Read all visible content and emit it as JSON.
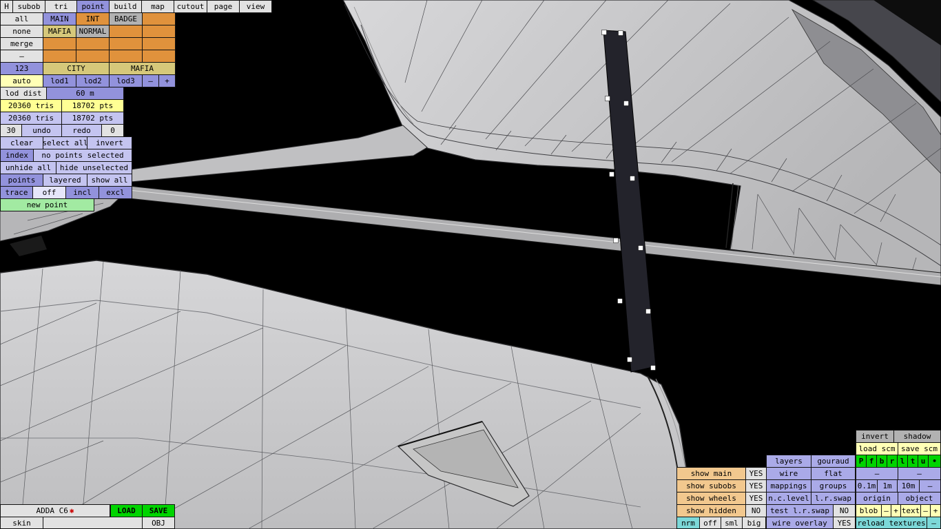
{
  "menubar": {
    "h": "H",
    "subob": "subob",
    "tri": "tri",
    "point": "point",
    "build": "build",
    "map": "map",
    "cutout": "cutout",
    "page": "page",
    "view": "view"
  },
  "left": {
    "all": "all",
    "main": "MAIN",
    "int": "INT",
    "badge": "BADGE",
    "none": "none",
    "mafia": "MAFIA",
    "normal": "NORMAL",
    "merge": "merge",
    "dash": "–",
    "grid_123": "123",
    "city": "CITY",
    "mafia_lod": "MAFIA",
    "auto": "auto",
    "lod1": "lod1",
    "lod2": "lod2",
    "lod3": "lod3",
    "lod_minus": "–",
    "lod_plus": "+",
    "lod_dist_label": "lod dist",
    "lod_dist_value": "60 m",
    "tris_a": "20360 tris",
    "pts_a": "18702 pts",
    "tris_b": "20360 tris",
    "pts_b": "18702 pts",
    "undo_count": "30",
    "undo": "undo",
    "redo": "redo",
    "redo_count": "0",
    "clear": "clear",
    "select_all": "select all",
    "invert": "invert",
    "index": "index",
    "selection_status": "no points selected",
    "unhide_all": "unhide all",
    "hide_unselected": "hide unselected",
    "points": "points",
    "layered": "layered",
    "show_all": "show all",
    "trace": "trace",
    "off": "off",
    "incl": "incl",
    "excl": "excl",
    "new_point": "new point"
  },
  "bottom_left": {
    "model": "ADDA C6",
    "modified_marker": "✱",
    "load": "LOAD",
    "save": "SAVE",
    "skin": "skin",
    "obj": "OBJ"
  },
  "right": {
    "invert": "invert",
    "shadow": "shadow",
    "load_scm": "load scm",
    "save_scm": "save scm",
    "layers": "layers",
    "gouraud": "gouraud",
    "views": [
      "P",
      "f",
      "b",
      "r",
      "l",
      "t",
      "u",
      "•"
    ],
    "show_main": "show main",
    "show_main_value": "YES",
    "wire": "wire",
    "flat": "flat",
    "dash_a": "–",
    "dash_b": "–",
    "show_subobs": "show subobs",
    "show_subobs_value": "YES",
    "mappings": "mappings",
    "groups": "groups",
    "grid_01": "0.1m",
    "grid_1": "1m",
    "grid_10": "10m",
    "grid_dash": "–",
    "show_wheels": "show wheels",
    "show_wheels_value": "YES",
    "nc_level": "n.c.level",
    "lr_swap": "l.r.swap",
    "origin": "origin",
    "object": "object",
    "show_hidden": "show hidden",
    "show_hidden_value": "NO",
    "test_lr_swap": "test l.r.swap",
    "test_lr_swap_value": "NO",
    "blob": "blob",
    "blob_minus": "–",
    "blob_plus": "+",
    "text": "text",
    "text_minus": "–",
    "text_plus": "+",
    "nrm": "nrm",
    "nrm_off": "off",
    "nrm_sml": "sml",
    "nrm_big": "big",
    "wire_overlay": "wire overlay",
    "wire_overlay_value": "YES",
    "reload_textures": "reload textures",
    "reload_dash": "–"
  },
  "colors": {
    "orange": "#e0923c",
    "purple": "#9292dc",
    "lavender": "#c4c4f0",
    "lavender_deep": "#aaaae8",
    "tan": "#d6c87a",
    "yellow": "#ffff94",
    "pale_yellow": "#ffffb6",
    "green": "#a2eaa2",
    "bright_green": "#00d400",
    "teal": "#7cd8d8",
    "peach": "#f2c88e",
    "modified_red": "#cc0000"
  }
}
